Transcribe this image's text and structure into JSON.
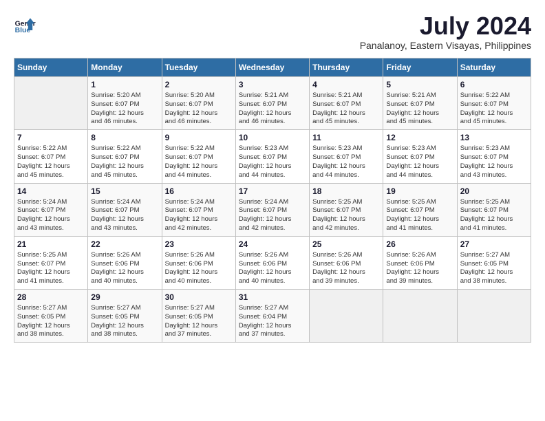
{
  "logo": {
    "line1": "General",
    "line2": "Blue"
  },
  "title": "July 2024",
  "location": "Panalanoy, Eastern Visayas, Philippines",
  "days_header": [
    "Sunday",
    "Monday",
    "Tuesday",
    "Wednesday",
    "Thursday",
    "Friday",
    "Saturday"
  ],
  "weeks": [
    [
      {
        "day": "",
        "info": ""
      },
      {
        "day": "1",
        "info": "Sunrise: 5:20 AM\nSunset: 6:07 PM\nDaylight: 12 hours\nand 46 minutes."
      },
      {
        "day": "2",
        "info": "Sunrise: 5:20 AM\nSunset: 6:07 PM\nDaylight: 12 hours\nand 46 minutes."
      },
      {
        "day": "3",
        "info": "Sunrise: 5:21 AM\nSunset: 6:07 PM\nDaylight: 12 hours\nand 46 minutes."
      },
      {
        "day": "4",
        "info": "Sunrise: 5:21 AM\nSunset: 6:07 PM\nDaylight: 12 hours\nand 45 minutes."
      },
      {
        "day": "5",
        "info": "Sunrise: 5:21 AM\nSunset: 6:07 PM\nDaylight: 12 hours\nand 45 minutes."
      },
      {
        "day": "6",
        "info": "Sunrise: 5:22 AM\nSunset: 6:07 PM\nDaylight: 12 hours\nand 45 minutes."
      }
    ],
    [
      {
        "day": "7",
        "info": "Sunrise: 5:22 AM\nSunset: 6:07 PM\nDaylight: 12 hours\nand 45 minutes."
      },
      {
        "day": "8",
        "info": "Sunrise: 5:22 AM\nSunset: 6:07 PM\nDaylight: 12 hours\nand 45 minutes."
      },
      {
        "day": "9",
        "info": "Sunrise: 5:22 AM\nSunset: 6:07 PM\nDaylight: 12 hours\nand 44 minutes."
      },
      {
        "day": "10",
        "info": "Sunrise: 5:23 AM\nSunset: 6:07 PM\nDaylight: 12 hours\nand 44 minutes."
      },
      {
        "day": "11",
        "info": "Sunrise: 5:23 AM\nSunset: 6:07 PM\nDaylight: 12 hours\nand 44 minutes."
      },
      {
        "day": "12",
        "info": "Sunrise: 5:23 AM\nSunset: 6:07 PM\nDaylight: 12 hours\nand 44 minutes."
      },
      {
        "day": "13",
        "info": "Sunrise: 5:23 AM\nSunset: 6:07 PM\nDaylight: 12 hours\nand 43 minutes."
      }
    ],
    [
      {
        "day": "14",
        "info": "Sunrise: 5:24 AM\nSunset: 6:07 PM\nDaylight: 12 hours\nand 43 minutes."
      },
      {
        "day": "15",
        "info": "Sunrise: 5:24 AM\nSunset: 6:07 PM\nDaylight: 12 hours\nand 43 minutes."
      },
      {
        "day": "16",
        "info": "Sunrise: 5:24 AM\nSunset: 6:07 PM\nDaylight: 12 hours\nand 42 minutes."
      },
      {
        "day": "17",
        "info": "Sunrise: 5:24 AM\nSunset: 6:07 PM\nDaylight: 12 hours\nand 42 minutes."
      },
      {
        "day": "18",
        "info": "Sunrise: 5:25 AM\nSunset: 6:07 PM\nDaylight: 12 hours\nand 42 minutes."
      },
      {
        "day": "19",
        "info": "Sunrise: 5:25 AM\nSunset: 6:07 PM\nDaylight: 12 hours\nand 41 minutes."
      },
      {
        "day": "20",
        "info": "Sunrise: 5:25 AM\nSunset: 6:07 PM\nDaylight: 12 hours\nand 41 minutes."
      }
    ],
    [
      {
        "day": "21",
        "info": "Sunrise: 5:25 AM\nSunset: 6:07 PM\nDaylight: 12 hours\nand 41 minutes."
      },
      {
        "day": "22",
        "info": "Sunrise: 5:26 AM\nSunset: 6:06 PM\nDaylight: 12 hours\nand 40 minutes."
      },
      {
        "day": "23",
        "info": "Sunrise: 5:26 AM\nSunset: 6:06 PM\nDaylight: 12 hours\nand 40 minutes."
      },
      {
        "day": "24",
        "info": "Sunrise: 5:26 AM\nSunset: 6:06 PM\nDaylight: 12 hours\nand 40 minutes."
      },
      {
        "day": "25",
        "info": "Sunrise: 5:26 AM\nSunset: 6:06 PM\nDaylight: 12 hours\nand 39 minutes."
      },
      {
        "day": "26",
        "info": "Sunrise: 5:26 AM\nSunset: 6:06 PM\nDaylight: 12 hours\nand 39 minutes."
      },
      {
        "day": "27",
        "info": "Sunrise: 5:27 AM\nSunset: 6:05 PM\nDaylight: 12 hours\nand 38 minutes."
      }
    ],
    [
      {
        "day": "28",
        "info": "Sunrise: 5:27 AM\nSunset: 6:05 PM\nDaylight: 12 hours\nand 38 minutes."
      },
      {
        "day": "29",
        "info": "Sunrise: 5:27 AM\nSunset: 6:05 PM\nDaylight: 12 hours\nand 38 minutes."
      },
      {
        "day": "30",
        "info": "Sunrise: 5:27 AM\nSunset: 6:05 PM\nDaylight: 12 hours\nand 37 minutes."
      },
      {
        "day": "31",
        "info": "Sunrise: 5:27 AM\nSunset: 6:04 PM\nDaylight: 12 hours\nand 37 minutes."
      },
      {
        "day": "",
        "info": ""
      },
      {
        "day": "",
        "info": ""
      },
      {
        "day": "",
        "info": ""
      }
    ]
  ]
}
